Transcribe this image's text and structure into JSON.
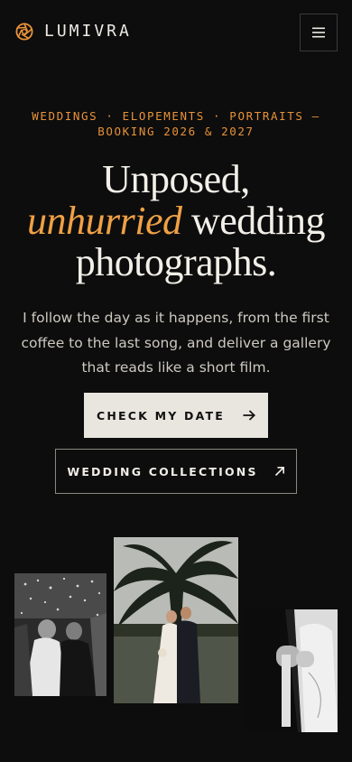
{
  "header": {
    "brand": "LUMIVRA",
    "logo_icon": "aperture-icon",
    "menu_icon": "hamburger-menu-icon",
    "accent_color": "#e8923a"
  },
  "hero": {
    "eyebrow": "WEDDINGS · ELOPEMENTS · PORTRAITS — BOOKING 2026 & 2027",
    "headline_line1": "Unposed,",
    "headline_accent": "unhurried",
    "headline_line2_rest": " wedding",
    "headline_line3": "photographs.",
    "lede": "I follow the day as it happens, from the first coffee to the last song, and deliver a gallery that reads like a short film.",
    "primary_cta": "CHECK MY DATE",
    "primary_cta_icon": "arrow-right-icon",
    "secondary_cta": "WEDDING COLLECTIONS",
    "secondary_cta_icon": "arrow-up-right-icon"
  },
  "gallery": {
    "photos": [
      {
        "name": "confetti-exit-photo",
        "style": "black-and-white"
      },
      {
        "name": "couple-under-palm-tree-photo",
        "style": "color"
      },
      {
        "name": "ring-exchange-photo",
        "style": "black-and-white"
      }
    ]
  }
}
